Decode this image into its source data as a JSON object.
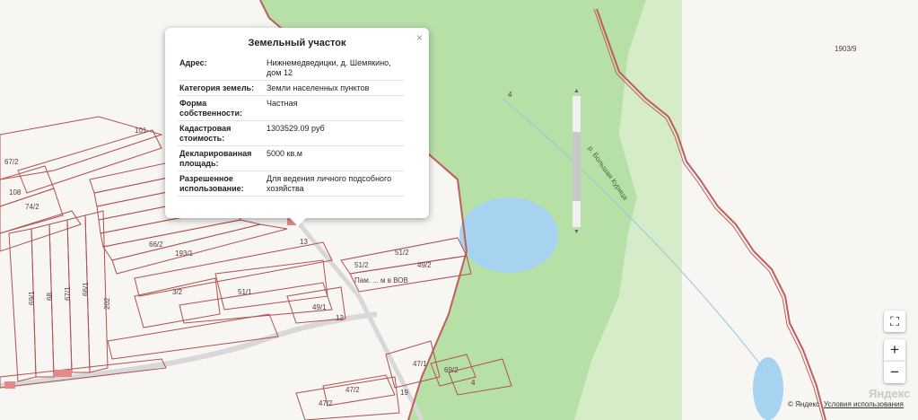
{
  "popup": {
    "title": "Земельный участок",
    "close": "×",
    "rows": [
      {
        "key": "Адрес:",
        "value": "Нижнемедведицки, д. Шемякино, дом 12"
      },
      {
        "key": "Категория земель:",
        "value": "Земли населенных пунктов"
      },
      {
        "key": "Форма собственности:",
        "value": "Частная"
      },
      {
        "key": "Кадастровая стоимость:",
        "value": "1303529.09 руб"
      },
      {
        "key": "Декларированная площадь:",
        "value": "5000 кв.м"
      },
      {
        "key": "Разрешенное использование:",
        "value": "Для ведения личного подсобного хозяйства"
      }
    ]
  },
  "map": {
    "labels": {
      "p101": "101",
      "p67_2": "67/2",
      "p108": "108",
      "p74_2": "74/2",
      "p69_1": "69/1",
      "p68": "68",
      "p67_1": "67/1",
      "p66_1": "66/1",
      "p202": "202",
      "p66_2": "66/2",
      "p193_1": "193/1",
      "p3_2": "3/2",
      "p51_1": "51/1",
      "p49_1": "49/1",
      "p12": "12",
      "p13": "13",
      "p51_2a": "51/2",
      "p51_2b": "51/2",
      "p49_2": "49/2",
      "p47_1": "47/1",
      "p69_2": "69/2",
      "p4b": "4",
      "p47_2a": "47/2",
      "p47_2b": "47/2",
      "p19": "19",
      "p4": "4",
      "p1903_9": "1903/9",
      "river": "р. Большая Курица",
      "memorial": "Пам. ... м в ВОВ"
    }
  },
  "controls": {
    "fullscreen": "⛶",
    "zoom_in": "+",
    "zoom_out": "−"
  },
  "footer": {
    "copyright": "© Яндекс",
    "terms": "Условия использования",
    "logo": "Яндекс"
  },
  "colors": {
    "forest": "#b7e0a7",
    "water": "#a6d3ef",
    "parcel_border": "#b05050",
    "road": "#d8d8d8"
  }
}
